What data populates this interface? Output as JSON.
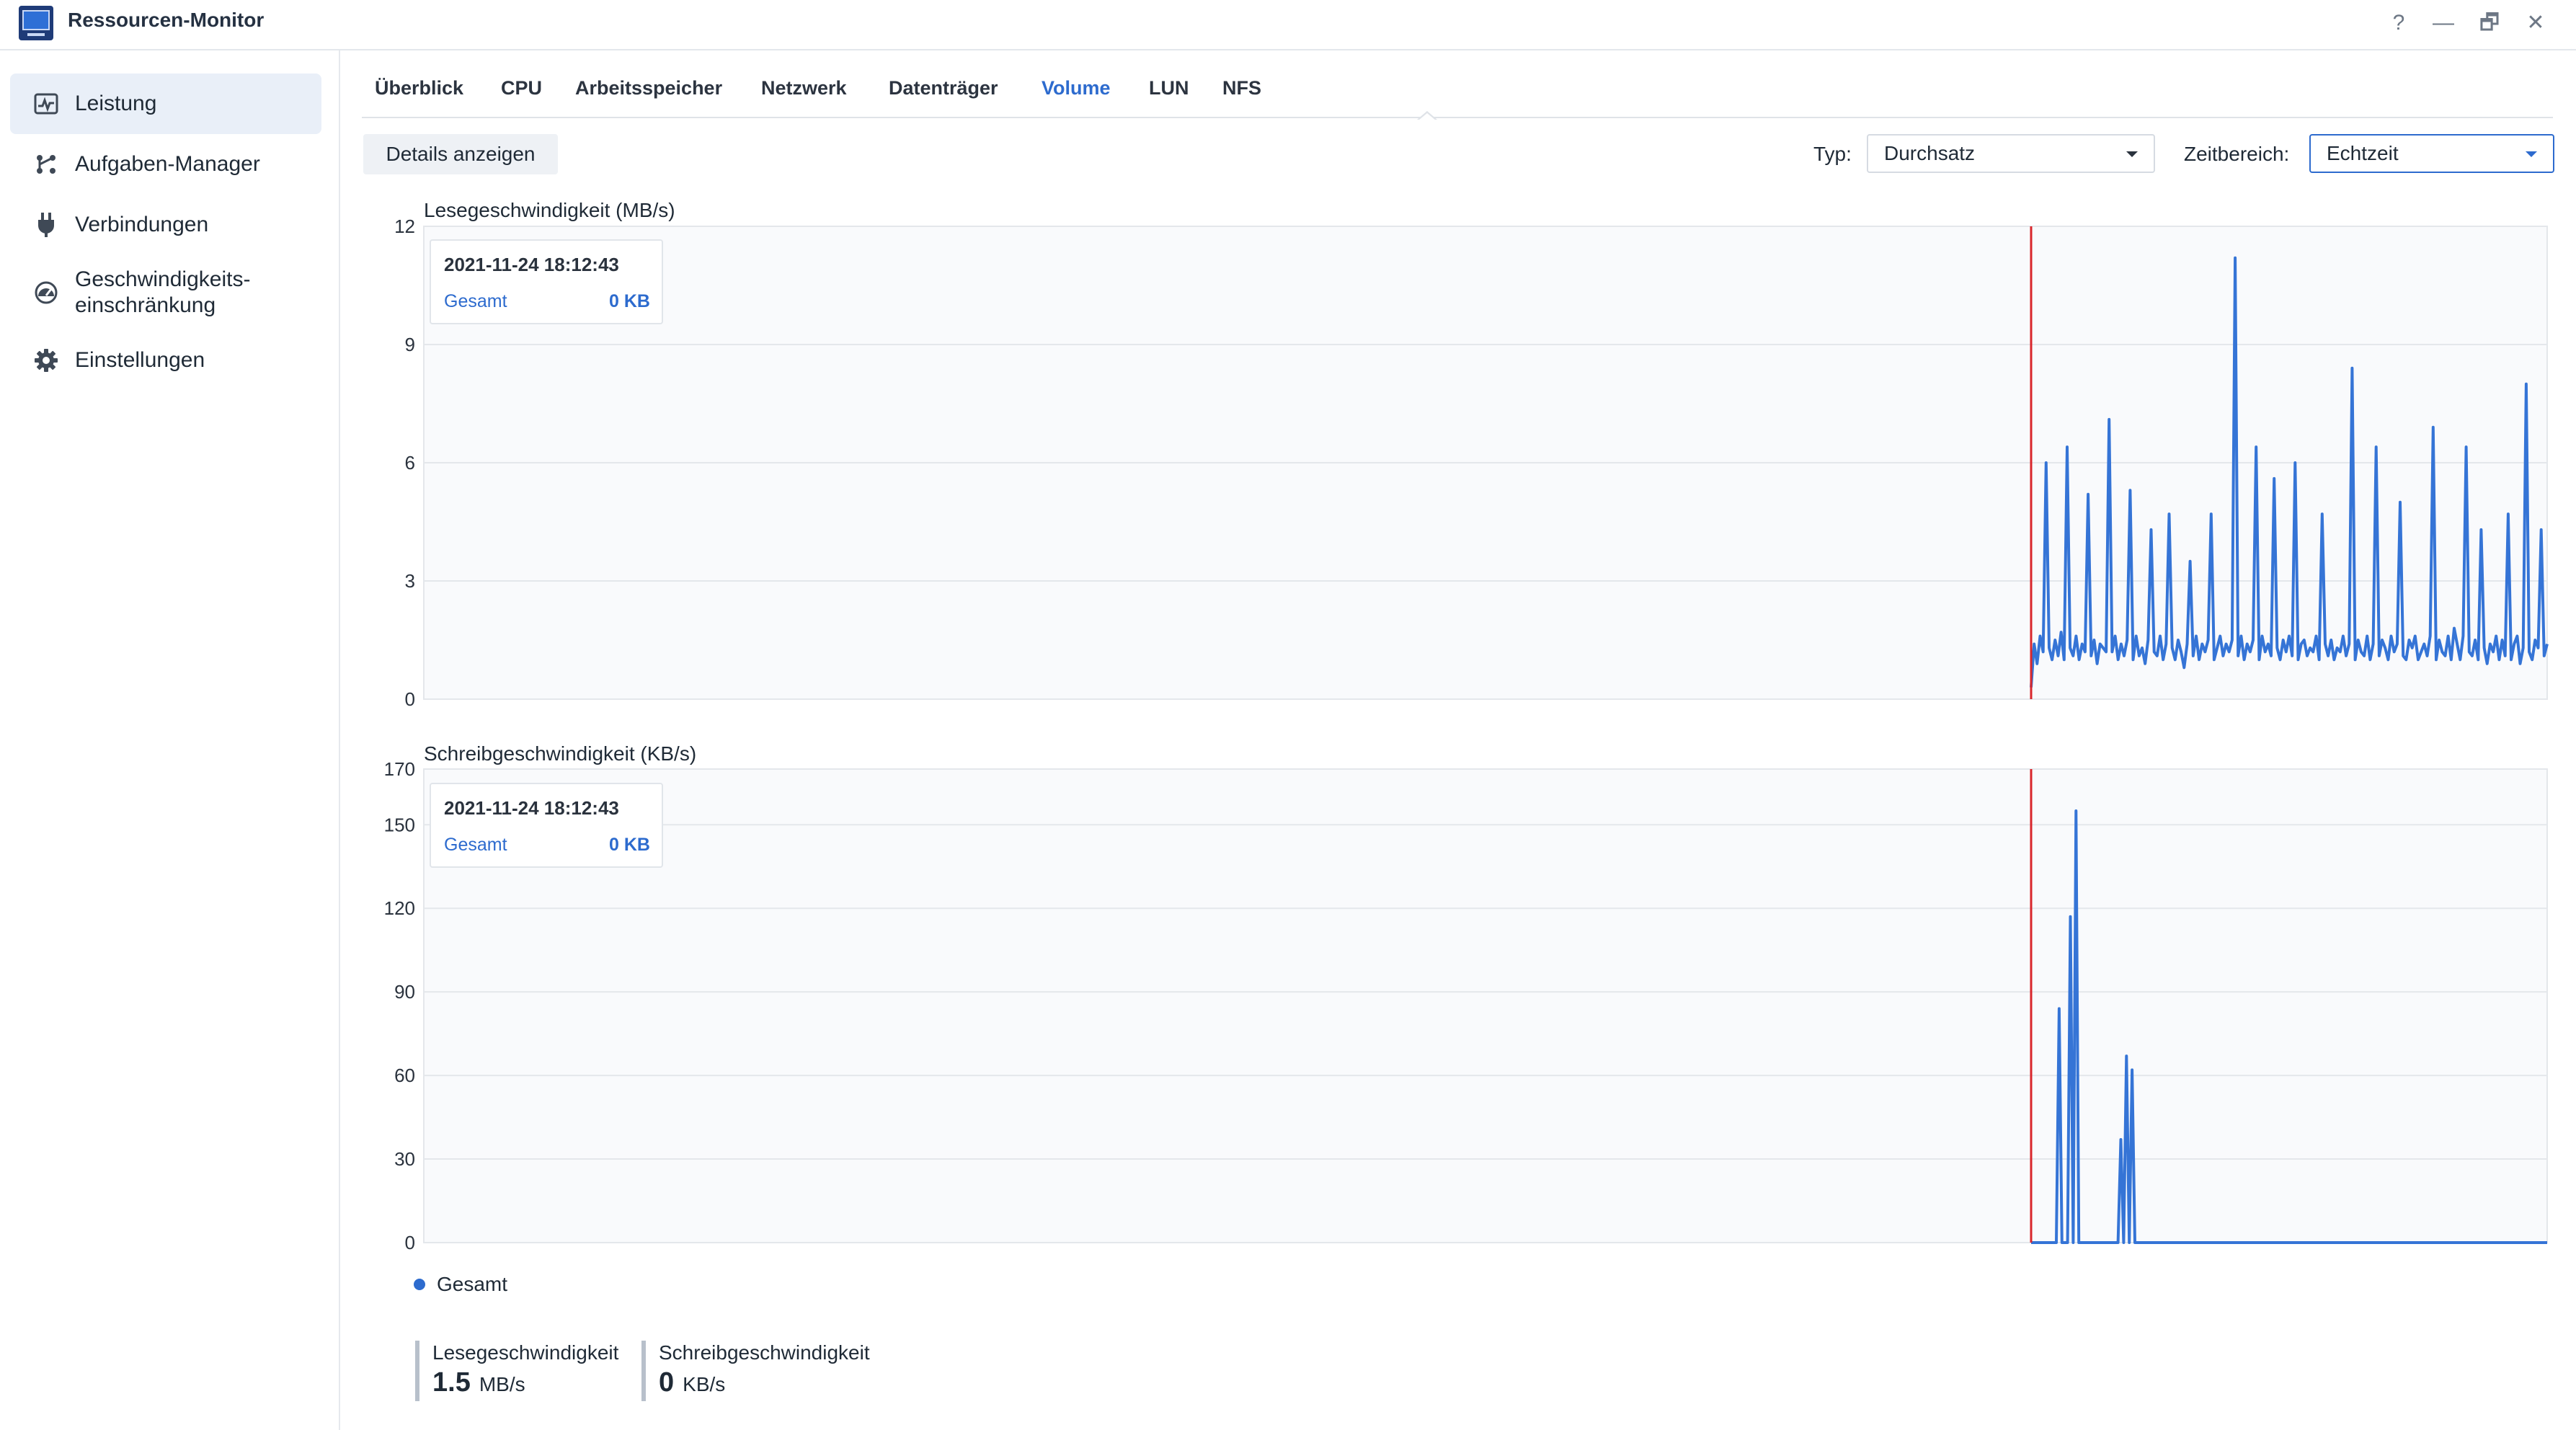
{
  "window": {
    "title": "Ressourcen-Monitor",
    "controls": {
      "help": "?",
      "minimize": "—",
      "restore": "🗗",
      "close": "✕"
    }
  },
  "sidebar": {
    "items": [
      {
        "label": "Leistung",
        "icon": "performance-icon",
        "active": true
      },
      {
        "label": "Aufgaben-Manager",
        "icon": "task-manager-icon"
      },
      {
        "label": "Verbindungen",
        "icon": "plug-icon"
      },
      {
        "label_line1": "Geschwindigkeits-",
        "label_line2": "einschränkung",
        "icon": "speedometer-icon"
      },
      {
        "label": "Einstellungen",
        "icon": "gear-icon"
      }
    ]
  },
  "tabs": [
    {
      "label": "Überblick"
    },
    {
      "label": "CPU"
    },
    {
      "label": "Arbeitsspeicher"
    },
    {
      "label": "Netzwerk"
    },
    {
      "label": "Datenträger"
    },
    {
      "label": "Volume",
      "active": true
    },
    {
      "label": "LUN"
    },
    {
      "label": "NFS"
    }
  ],
  "toolbar": {
    "details_button": "Details anzeigen",
    "type_label": "Typ:",
    "type_value": "Durchsatz",
    "range_label": "Zeitbereich:",
    "range_value": "Echtzeit"
  },
  "colors": {
    "accent": "#2d6bce",
    "series": "#3574d6",
    "marker": "#d9262b",
    "grid": "#e4e7eb"
  },
  "chart_data": [
    {
      "type": "line",
      "title": "Lesegeschwindigkeit (MB/s)",
      "ylim": [
        0,
        12
      ],
      "yticks": [
        "0",
        "3",
        "6",
        "9",
        "12"
      ],
      "grid": true,
      "marker_index": 0,
      "series": [
        {
          "name": "Gesamt",
          "values": [
            0.3,
            1.4,
            0.9,
            1.6,
            1.2,
            6.0,
            1.3,
            1.0,
            1.5,
            1.1,
            1.7,
            1.0,
            6.4,
            1.3,
            1.1,
            1.6,
            1.0,
            1.4,
            1.2,
            5.2,
            1.1,
            1.5,
            0.9,
            1.4,
            1.3,
            1.2,
            7.1,
            1.2,
            1.6,
            1.0,
            1.4,
            1.1,
            1.5,
            5.3,
            1.0,
            1.6,
            1.1,
            1.3,
            0.9,
            1.5,
            4.3,
            1.2,
            1.1,
            1.6,
            1.0,
            1.4,
            4.7,
            1.3,
            1.0,
            1.5,
            1.2,
            0.8,
            1.4,
            3.5,
            1.1,
            1.6,
            1.0,
            1.4,
            1.2,
            1.5,
            4.7,
            1.0,
            1.3,
            1.6,
            1.1,
            1.4,
            1.2,
            1.5,
            11.2,
            1.1,
            1.6,
            1.0,
            1.4,
            1.2,
            1.5,
            6.4,
            1.0,
            1.6,
            1.2,
            1.4,
            1.1,
            5.6,
            1.3,
            1.0,
            1.5,
            1.2,
            1.6,
            1.1,
            6.0,
            1.0,
            1.4,
            1.5,
            1.1,
            1.3,
            1.2,
            1.6,
            1.0,
            4.7,
            1.4,
            1.1,
            1.5,
            1.0,
            1.3,
            1.2,
            1.6,
            1.1,
            1.4,
            8.4,
            1.0,
            1.5,
            1.2,
            1.1,
            1.6,
            1.0,
            1.4,
            6.4,
            1.1,
            1.5,
            1.3,
            1.0,
            1.6,
            1.2,
            1.4,
            5.0,
            1.1,
            1.0,
            1.5,
            1.3,
            1.6,
            1.0,
            1.2,
            1.4,
            1.1,
            1.6,
            6.9,
            1.0,
            1.5,
            1.2,
            1.1,
            1.6,
            1.0,
            1.8,
            1.4,
            1.0,
            1.6,
            6.4,
            1.2,
            1.1,
            1.5,
            1.0,
            4.3,
            1.3,
            0.9,
            1.4,
            1.2,
            1.6,
            1.0,
            1.5,
            1.1,
            4.7,
            1.0,
            1.4,
            1.6,
            0.9,
            1.3,
            8.0,
            1.2,
            1.0,
            1.5,
            1.3,
            4.3,
            1.1,
            1.4
          ]
        }
      ]
    },
    {
      "type": "line",
      "title": "Schreibgeschwindigkeit (KB/s)",
      "ylim": [
        0,
        170
      ],
      "yticks": [
        "0",
        "30",
        "60",
        "90",
        "120",
        "150",
        "170"
      ],
      "grid": true,
      "marker_index": 0,
      "series": [
        {
          "name": "Gesamt",
          "values": [
            0,
            0,
            0,
            0,
            0,
            0,
            0,
            0,
            0,
            0,
            84,
            0,
            0,
            0,
            117,
            0,
            155,
            0,
            0,
            0,
            0,
            0,
            0,
            0,
            0,
            0,
            0,
            0,
            0,
            0,
            0,
            0,
            37,
            0,
            67,
            0,
            62,
            0,
            0,
            0,
            0,
            0,
            0,
            0,
            0,
            0,
            0,
            0,
            0,
            0,
            0,
            0,
            0,
            0,
            0,
            0,
            0,
            0,
            0,
            0,
            0,
            0,
            0,
            0,
            0,
            0,
            0,
            0,
            0,
            0,
            0,
            0,
            0,
            0,
            0,
            0,
            0,
            0,
            0,
            0,
            0,
            0,
            0,
            0,
            0,
            0,
            0,
            0,
            0,
            0,
            0,
            0,
            0,
            0,
            0,
            0,
            0,
            0,
            0,
            0,
            0,
            0,
            0,
            0,
            0,
            0,
            0,
            0,
            0,
            0,
            0,
            0,
            0,
            0,
            0,
            0,
            0,
            0,
            0,
            0,
            0,
            0,
            0,
            0,
            0,
            0,
            0,
            0,
            0,
            0,
            0,
            0,
            0,
            0,
            0,
            0,
            0,
            0,
            0,
            0,
            0,
            0,
            0,
            0,
            0,
            0,
            0,
            0,
            0,
            0,
            0,
            0,
            0,
            0,
            0,
            0,
            0,
            0,
            0,
            0,
            0,
            0,
            0,
            0,
            0,
            0,
            0,
            0,
            0,
            0,
            0,
            0,
            0,
            0,
            0,
            0,
            0,
            0,
            0,
            0,
            0,
            0,
            0,
            0,
            0
          ]
        }
      ]
    }
  ],
  "tooltips": [
    {
      "time": "2021-11-24 18:12:43",
      "series": "Gesamt",
      "value": "0 KB"
    },
    {
      "time": "2021-11-24 18:12:43",
      "series": "Gesamt",
      "value": "0 KB"
    }
  ],
  "legend": {
    "label": "Gesamt"
  },
  "summary": [
    {
      "label": "Lesegeschwindigkeit",
      "value": "1.5",
      "unit": "MB/s"
    },
    {
      "label": "Schreibgeschwindigkeit",
      "value": "0",
      "unit": "KB/s"
    }
  ]
}
